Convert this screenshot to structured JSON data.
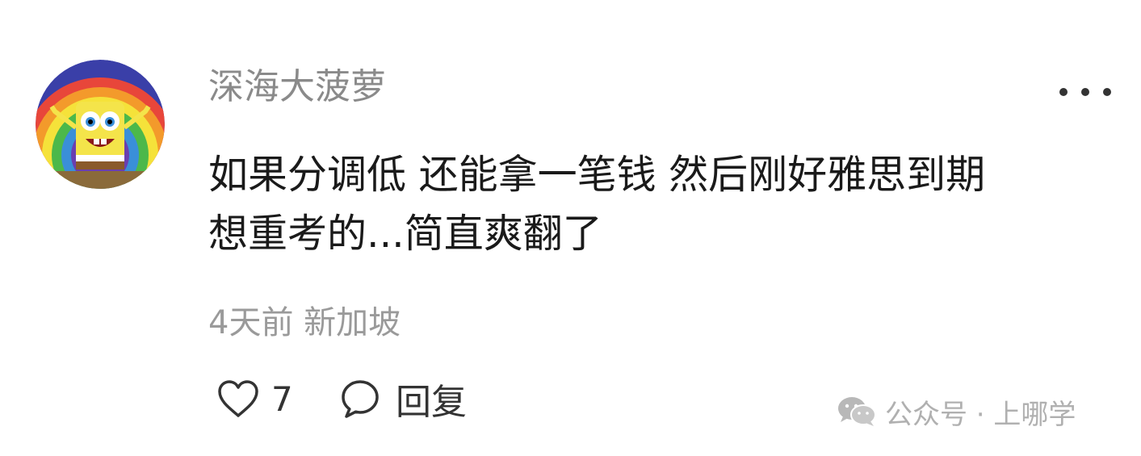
{
  "comment": {
    "avatar_icon": "spongebob-rainbow-avatar",
    "username": "深海大菠萝",
    "more_icon": "more-dots-icon",
    "content": "如果分调低 还能拿一笔钱 然后刚好雅思到期\n想重考的...简直爽翻了",
    "meta": "4天前 新加坡",
    "like_icon": "heart-outline-icon",
    "like_count": "7",
    "reply_icon": "speech-bubble-icon",
    "reply_label": "回复"
  },
  "watermark": {
    "icon": "wechat-icon",
    "text": "公众号 · 上哪学"
  },
  "colors": {
    "username": "#8a8a8a",
    "content": "#1a1a1a",
    "meta": "#9a9a9a",
    "actions": "#333333",
    "watermark": "#b0b0b0"
  }
}
